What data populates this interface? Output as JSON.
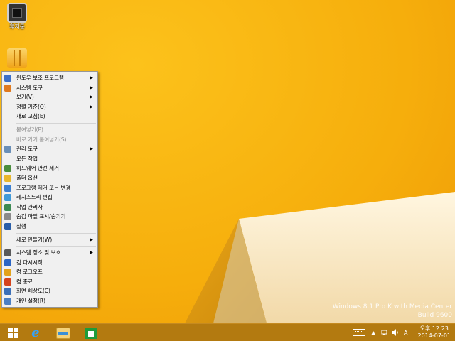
{
  "desktop": {
    "icons": [
      {
        "label": "휴지통",
        "icon": "recycle-bin-icon"
      },
      {
        "label": "",
        "icon": "folder-stack-icon"
      }
    ],
    "watermark": {
      "line1": "Windows 8.1 Pro K with Media Center",
      "line2": "Build 9600"
    }
  },
  "context_menu": {
    "items": [
      {
        "label": "윈도우 보조 프로그램",
        "icon": "accessories-icon",
        "color": "#3b6fc9",
        "submenu": true,
        "enabled": true
      },
      {
        "label": "시스템 도구",
        "icon": "system-tools-icon",
        "color": "#e07a20",
        "submenu": true,
        "enabled": true
      },
      {
        "label": "보기(V)",
        "icon": "",
        "submenu": true,
        "enabled": true
      },
      {
        "label": "정렬 기준(O)",
        "icon": "",
        "submenu": true,
        "enabled": true
      },
      {
        "label": "새로 고침(E)",
        "icon": "",
        "submenu": false,
        "enabled": true
      },
      {
        "sep": true
      },
      {
        "label": "붙여넣기(P)",
        "icon": "",
        "submenu": false,
        "enabled": false
      },
      {
        "label": "바로 가기 붙여넣기(S)",
        "icon": "",
        "submenu": false,
        "enabled": false
      },
      {
        "label": "관리 도구",
        "icon": "admin-tools-icon",
        "color": "#6a8fb8",
        "submenu": true,
        "enabled": true
      },
      {
        "label": "모든 작업",
        "icon": "",
        "submenu": false,
        "enabled": true
      },
      {
        "label": "하드웨어 안전 제거",
        "icon": "safely-remove-icon",
        "color": "#4a8d3c",
        "submenu": false,
        "enabled": true
      },
      {
        "label": "폴더 옵션",
        "icon": "folder-options-icon",
        "color": "#e8b62c",
        "submenu": false,
        "enabled": true
      },
      {
        "label": "프로그램 제거 또는 변경",
        "icon": "programs-icon",
        "color": "#3b7fd0",
        "submenu": false,
        "enabled": true
      },
      {
        "label": "레지스트리 편집",
        "icon": "registry-icon",
        "color": "#3f9ad8",
        "submenu": false,
        "enabled": true
      },
      {
        "label": "작업 관리자",
        "icon": "task-manager-icon",
        "color": "#3c8a52",
        "submenu": false,
        "enabled": true
      },
      {
        "label": "숨김 파일 표시/숨기기",
        "icon": "hidden-files-icon",
        "color": "#8a8a8a",
        "submenu": false,
        "enabled": true
      },
      {
        "label": "실행",
        "icon": "run-icon",
        "color": "#2a5ea8",
        "submenu": false,
        "enabled": true
      },
      {
        "sep": true
      },
      {
        "label": "새로 만들기(W)",
        "icon": "",
        "submenu": true,
        "enabled": true
      },
      {
        "sep": true
      },
      {
        "label": "시스템 정소 및 보호",
        "icon": "system-protection-icon",
        "color": "#5a5a5a",
        "submenu": true,
        "enabled": true
      },
      {
        "label": "컴 다시시작",
        "icon": "restart-icon",
        "color": "#2c66c4",
        "submenu": false,
        "enabled": true
      },
      {
        "label": "컴 로그오프",
        "icon": "logoff-icon",
        "color": "#e3a21a",
        "submenu": false,
        "enabled": true
      },
      {
        "label": "컴 종료",
        "icon": "shutdown-icon",
        "color": "#d4431d",
        "submenu": false,
        "enabled": true
      },
      {
        "label": "화면 해상도(C)",
        "icon": "display-icon",
        "color": "#3a6fb8",
        "submenu": false,
        "enabled": true
      },
      {
        "label": "개인 설정(R)",
        "icon": "personalize-icon",
        "color": "#4a7fc4",
        "submenu": false,
        "enabled": true
      }
    ]
  },
  "taskbar": {
    "buttons": [
      {
        "name": "start-button",
        "icon": "windows-logo-icon"
      },
      {
        "name": "internet-explorer-button",
        "icon": "internet-explorer-icon",
        "glyph": "e"
      },
      {
        "name": "file-explorer-button",
        "icon": "file-explorer-icon"
      },
      {
        "name": "store-button",
        "icon": "store-icon"
      }
    ],
    "tray": {
      "chevron": "▲",
      "ime": "A",
      "time": "오후 12:23",
      "date": "2014-07-01"
    }
  },
  "colors": {
    "wallpaper": "#f6b40f",
    "taskbar": "#b37a10",
    "menu_bg": "#f0f0f0"
  }
}
